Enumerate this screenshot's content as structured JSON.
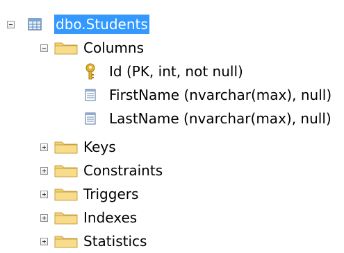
{
  "tree": {
    "root": {
      "label": "dbo.Students",
      "expanded": true,
      "selected": true,
      "icon": "table-icon"
    },
    "columns_folder": {
      "label": "Columns",
      "expanded": true,
      "icon": "folder-icon",
      "items": [
        {
          "label": "Id (PK, int, not null)",
          "icon": "key-icon"
        },
        {
          "label": "FirstName (nvarchar(max), null)",
          "icon": "column-icon"
        },
        {
          "label": "LastName (nvarchar(max), null)",
          "icon": "column-icon"
        }
      ]
    },
    "folders": [
      {
        "label": "Keys",
        "expanded": false,
        "icon": "folder-icon"
      },
      {
        "label": "Constraints",
        "expanded": false,
        "icon": "folder-icon"
      },
      {
        "label": "Triggers",
        "expanded": false,
        "icon": "folder-icon"
      },
      {
        "label": "Indexes",
        "expanded": false,
        "icon": "folder-icon"
      },
      {
        "label": "Statistics",
        "expanded": false,
        "icon": "folder-icon"
      }
    ]
  },
  "colors": {
    "selection": "#3399ff",
    "folder": "#f3d27a",
    "key": "#e6b22e"
  }
}
